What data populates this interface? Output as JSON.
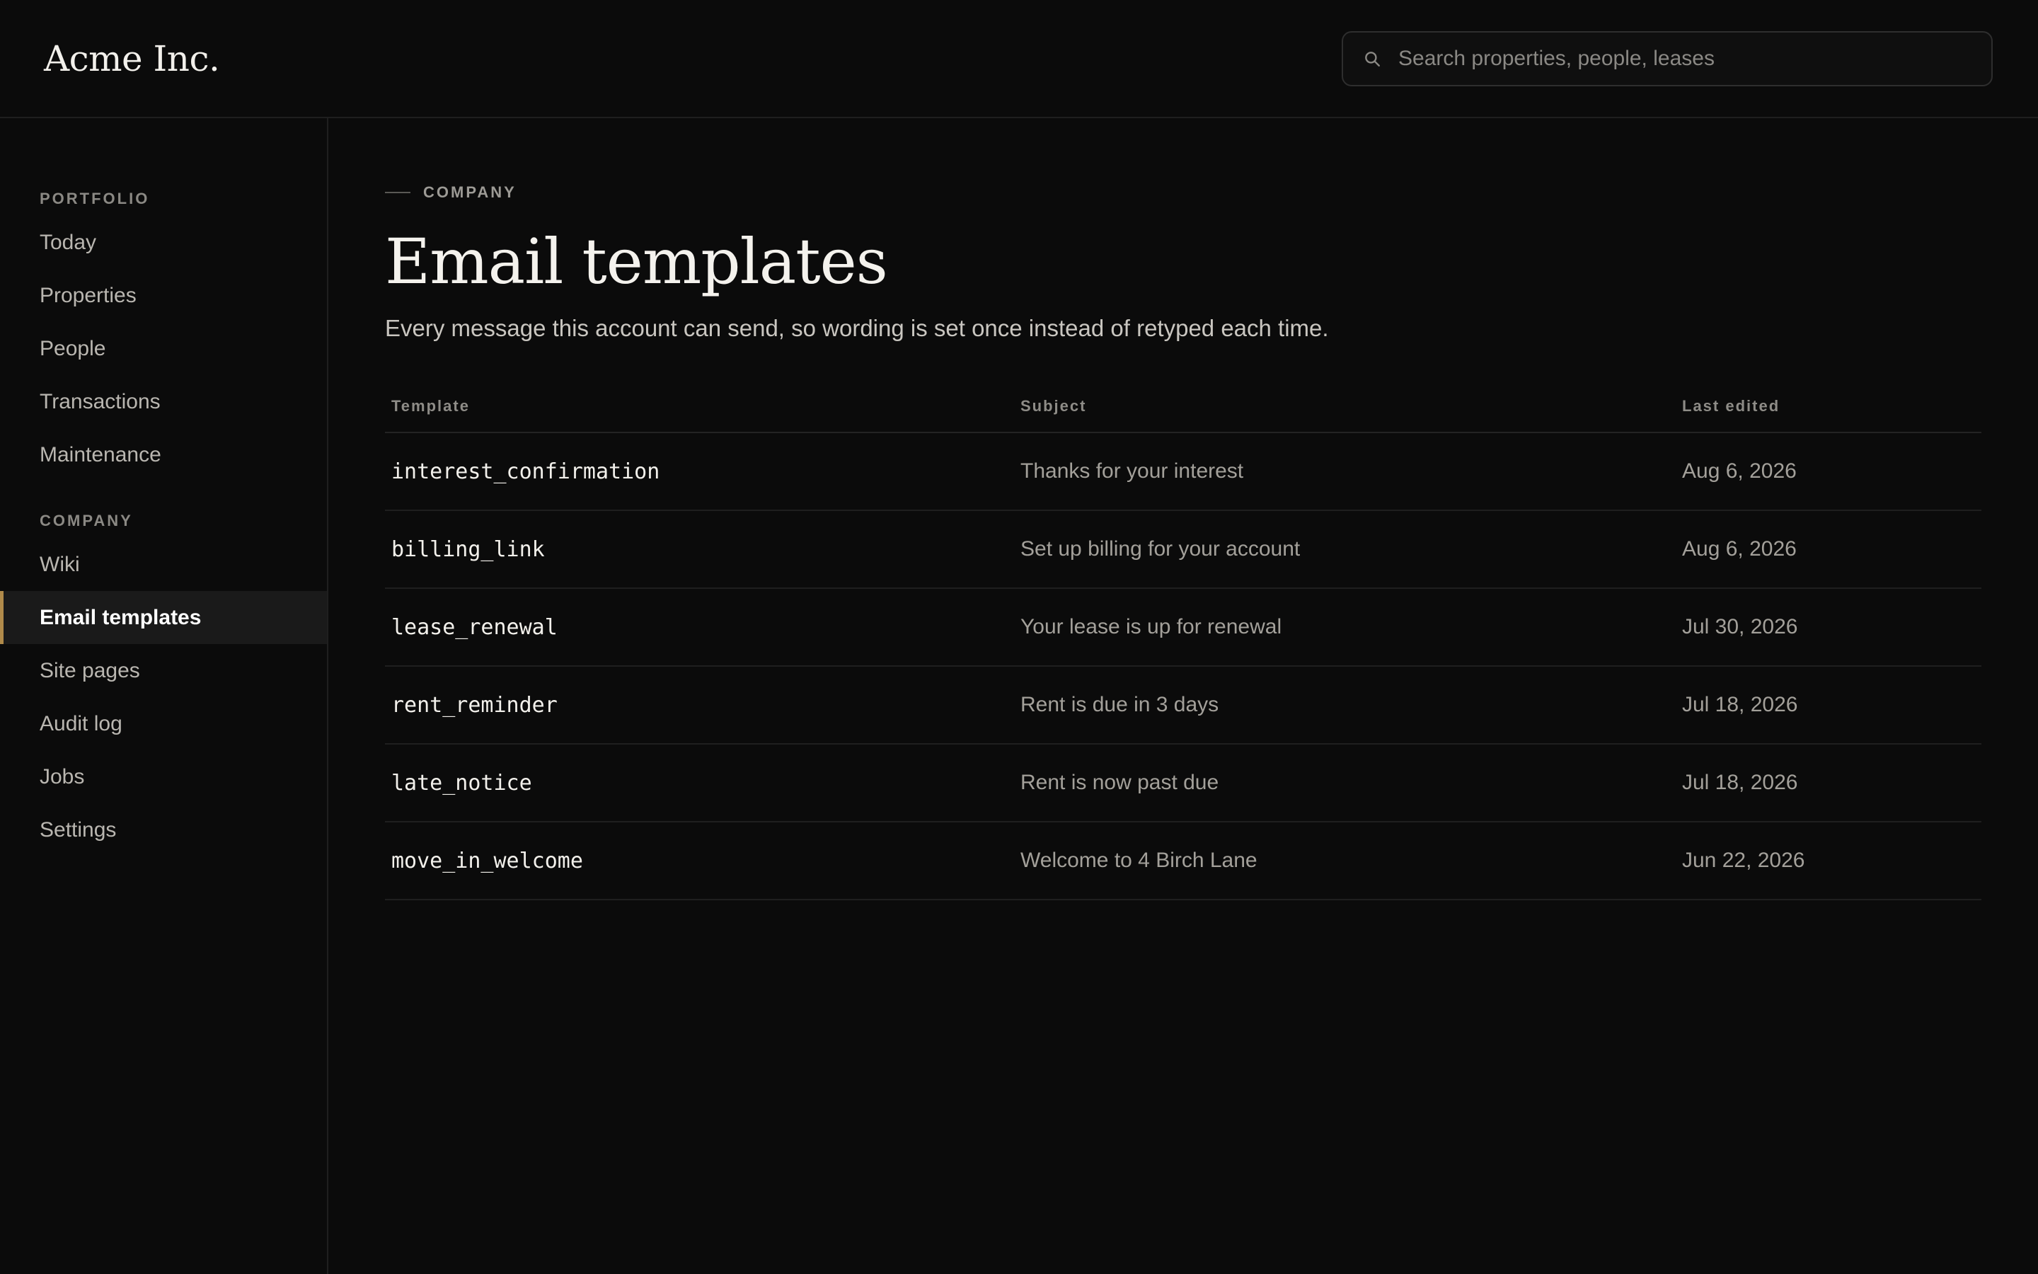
{
  "header": {
    "brand": "Acme Inc.",
    "search_placeholder": "Search properties, people, leases"
  },
  "sidebar": {
    "sections": [
      {
        "label": "PORTFOLIO",
        "items": [
          {
            "label": "Today"
          },
          {
            "label": "Properties"
          },
          {
            "label": "People"
          },
          {
            "label": "Transactions"
          },
          {
            "label": "Maintenance"
          }
        ]
      },
      {
        "label": "COMPANY",
        "items": [
          {
            "label": "Wiki"
          },
          {
            "label": "Email templates",
            "active": true
          },
          {
            "label": "Site pages"
          },
          {
            "label": "Audit log"
          },
          {
            "label": "Jobs"
          },
          {
            "label": "Settings"
          }
        ]
      }
    ]
  },
  "main": {
    "eyebrow": "COMPANY",
    "title": "Email templates",
    "subtitle": "Every message this account can send, so wording is set once instead of retyped each time.",
    "table": {
      "headers": [
        "Template",
        "Subject",
        "Last edited"
      ],
      "rows": [
        {
          "template": "interest_confirmation",
          "subject": "Thanks for your interest",
          "last_edited": "Aug 6, 2026"
        },
        {
          "template": "billing_link",
          "subject": "Set up billing for your account",
          "last_edited": "Aug 6, 2026"
        },
        {
          "template": "lease_renewal",
          "subject": "Your lease is up for renewal",
          "last_edited": "Jul 30, 2026"
        },
        {
          "template": "rent_reminder",
          "subject": "Rent is due in 3 days",
          "last_edited": "Jul 18, 2026"
        },
        {
          "template": "late_notice",
          "subject": "Rent is now past due",
          "last_edited": "Jul 18, 2026"
        },
        {
          "template": "move_in_welcome",
          "subject": "Welcome to 4 Birch Lane",
          "last_edited": "Jun 22, 2026"
        }
      ]
    }
  },
  "colors": {
    "background": "#0b0b0b",
    "accent": "#b08a4a",
    "active_item_bg": "#1a1a1a"
  }
}
